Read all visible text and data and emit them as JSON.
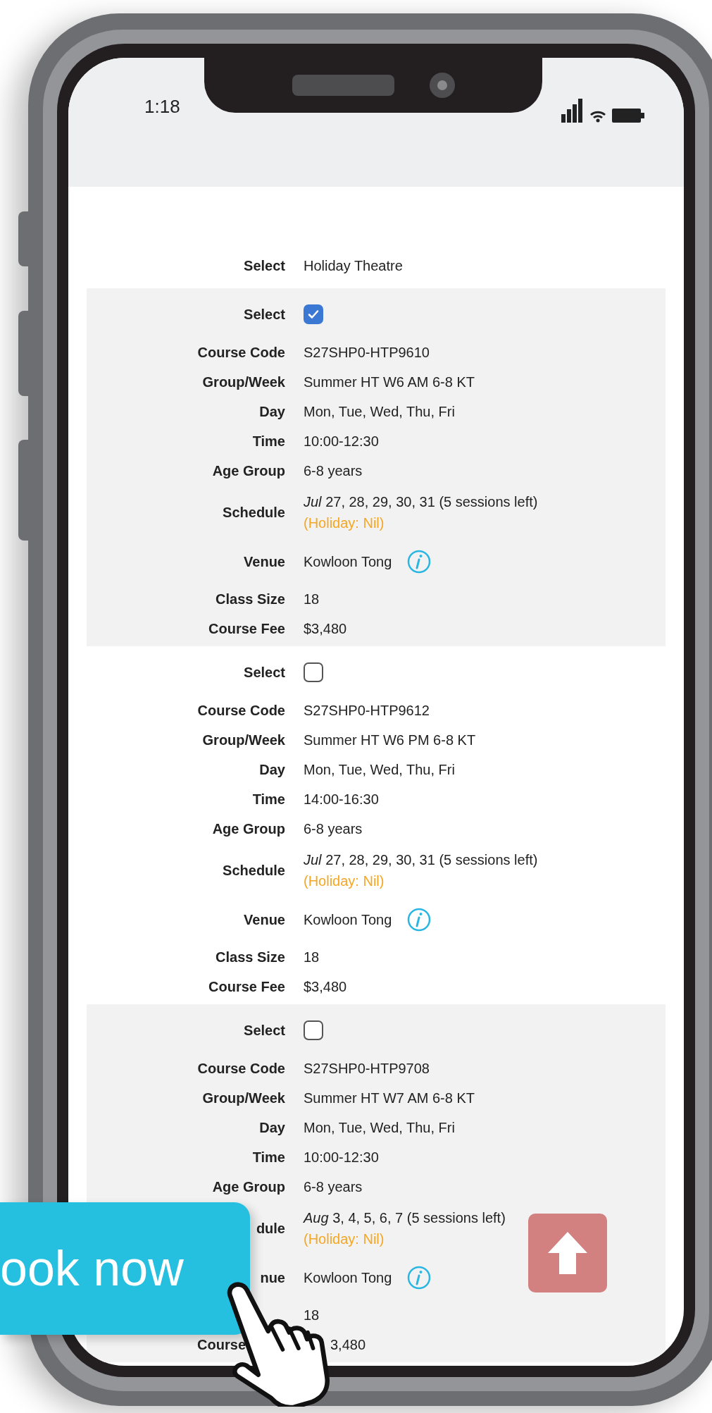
{
  "status_bar": {
    "time": "1:18"
  },
  "header_row": {
    "label": "Select",
    "value": "Holiday Theatre"
  },
  "courses": [
    {
      "fields": [
        {
          "kind": "checkbox",
          "label": "Select",
          "checked": true
        },
        {
          "kind": "text",
          "label": "Course Code",
          "value": "S27SHP0-HTP9610"
        },
        {
          "kind": "text",
          "label": "Group/Week",
          "value": "Summer HT W6 AM 6-8 KT"
        },
        {
          "kind": "text",
          "label": "Day",
          "value": "Mon, Tue, Wed, Thu, Fri"
        },
        {
          "kind": "text",
          "label": "Time",
          "value": "10:00-12:30"
        },
        {
          "kind": "text",
          "label": "Age Group",
          "value": "6-8 years"
        },
        {
          "kind": "schedule",
          "label": "Schedule",
          "value": "*Jul* 27, 28, 29, 30, 31 (5 sessions left)",
          "note": "(Holiday: Nil)"
        },
        {
          "kind": "venue",
          "label": "Venue",
          "value": "Kowloon Tong"
        },
        {
          "kind": "text",
          "label": "Class Size",
          "value": "18"
        },
        {
          "kind": "text",
          "label": "Course Fee",
          "value": "$3,480"
        }
      ]
    },
    {
      "fields": [
        {
          "kind": "checkbox",
          "label": "Select",
          "checked": false
        },
        {
          "kind": "text",
          "label": "Course Code",
          "value": "S27SHP0-HTP9612"
        },
        {
          "kind": "text",
          "label": "Group/Week",
          "value": "Summer HT W6 PM 6-8 KT"
        },
        {
          "kind": "text",
          "label": "Day",
          "value": "Mon, Tue, Wed, Thu, Fri"
        },
        {
          "kind": "text",
          "label": "Time",
          "value": "14:00-16:30"
        },
        {
          "kind": "text",
          "label": "Age Group",
          "value": "6-8 years"
        },
        {
          "kind": "schedule",
          "label": "Schedule",
          "value": "*Jul* 27, 28, 29, 30, 31 (5 sessions left)",
          "note": "(Holiday: Nil)"
        },
        {
          "kind": "venue",
          "label": "Venue",
          "value": "Kowloon Tong"
        },
        {
          "kind": "text",
          "label": "Class Size",
          "value": "18"
        },
        {
          "kind": "text",
          "label": "Course Fee",
          "value": "$3,480"
        }
      ]
    },
    {
      "fields": [
        {
          "kind": "checkbox",
          "label": "Select",
          "checked": false
        },
        {
          "kind": "text",
          "label": "Course Code",
          "value": "S27SHP0-HTP9708"
        },
        {
          "kind": "text",
          "label": "Group/Week",
          "value": "Summer HT W7 AM 6-8 KT"
        },
        {
          "kind": "text",
          "label": "Day",
          "value": "Mon, Tue, Wed, Thu, Fri"
        },
        {
          "kind": "text",
          "label": "Time",
          "value": "10:00-12:30"
        },
        {
          "kind": "text",
          "label": "Age Group",
          "value": "6-8 years"
        },
        {
          "kind": "schedule",
          "label": "dule",
          "value": "*Aug* 3, 4, 5, 6, 7 (5 sessions left)",
          "note": "(Holiday: Nil)"
        },
        {
          "kind": "venue",
          "label": "nue",
          "value": "Kowloon Tong"
        },
        {
          "kind": "text",
          "value": "18"
        },
        {
          "kind": "covered",
          "label": "Course",
          "value": "3,480"
        }
      ]
    }
  ],
  "book_button": {
    "label": "ook now"
  }
}
